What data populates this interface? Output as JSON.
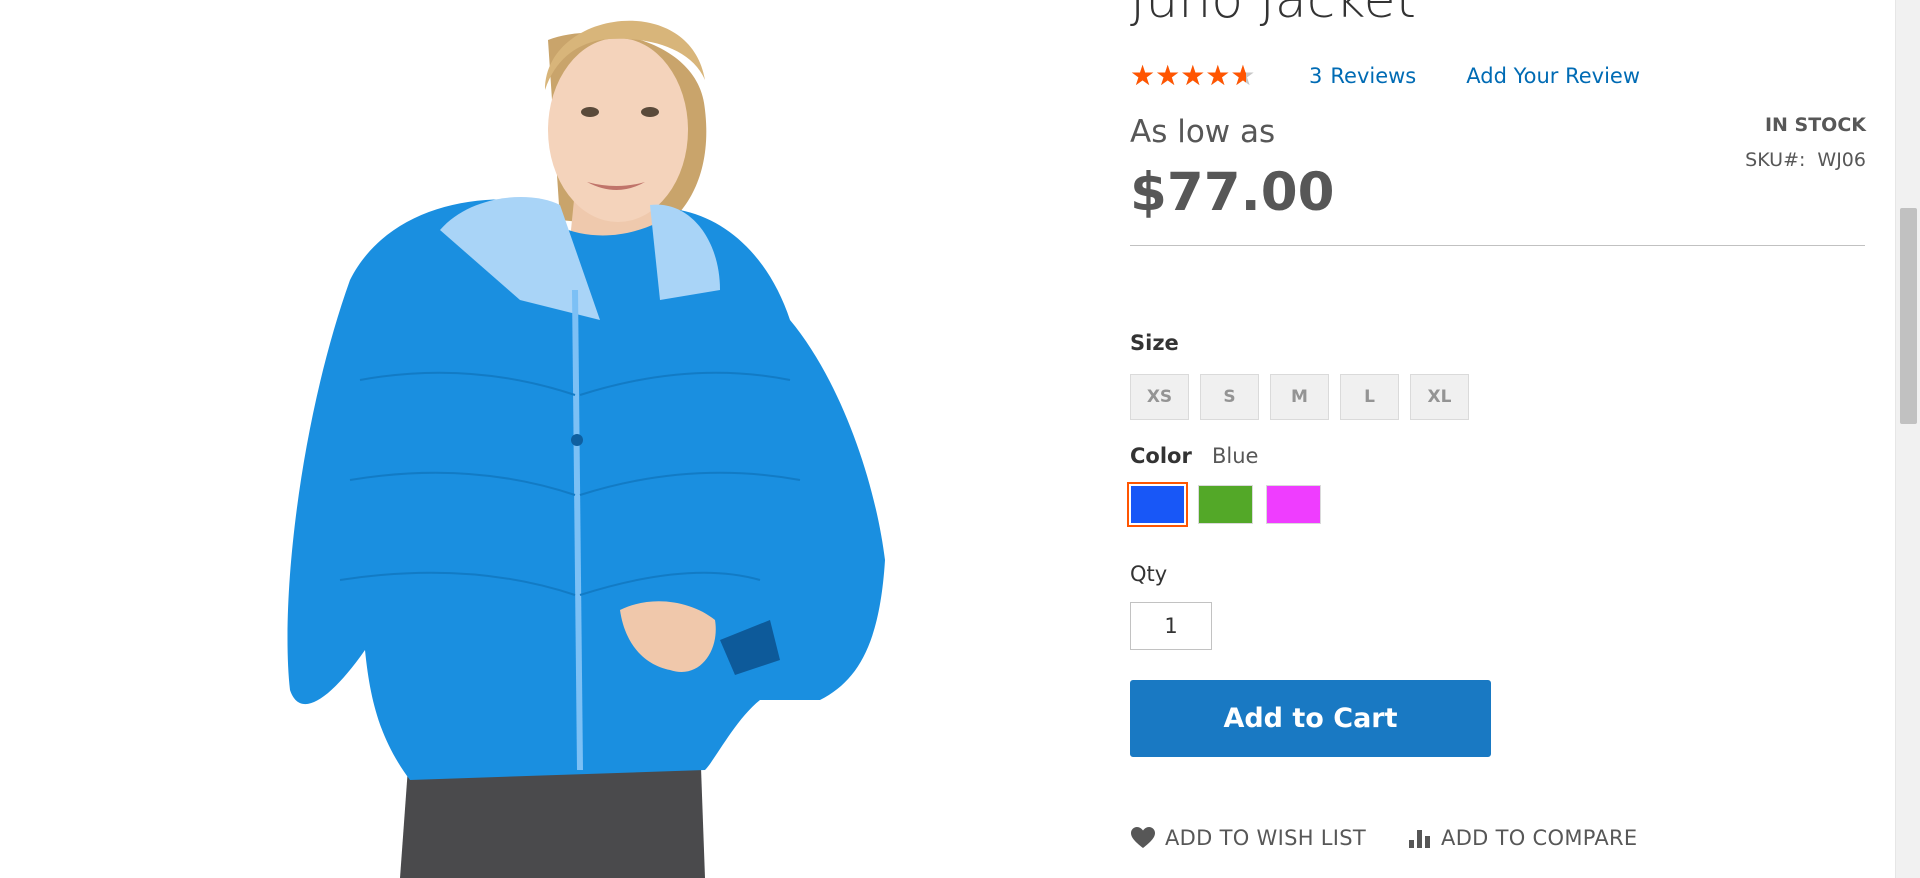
{
  "product": {
    "title": "Juno Jacket",
    "rating_percent": 87,
    "stars_glyphs": "★★★★★",
    "reviews_count": "3",
    "reviews_label": "Reviews",
    "add_review_label": "Add Your Review",
    "price_label": "As low as",
    "price": "$77.00",
    "stock_status": "IN STOCK",
    "sku_label": "SKU#:",
    "sku_value": "WJ06"
  },
  "options": {
    "size_label": "Size",
    "sizes": [
      "XS",
      "S",
      "M",
      "L",
      "XL"
    ],
    "color_label": "Color",
    "color_selected": "Blue",
    "colors": [
      {
        "name": "Blue",
        "hex": "#1857f7",
        "selected": true
      },
      {
        "name": "Green",
        "hex": "#53a828",
        "selected": false
      },
      {
        "name": "Purple",
        "hex": "#ef3dff",
        "selected": false
      }
    ]
  },
  "qty": {
    "label": "Qty",
    "value": "1"
  },
  "actions": {
    "add_to_cart": "Add to Cart",
    "wish_list": "ADD TO WISH LIST",
    "compare": "ADD TO COMPARE"
  },
  "colors": {
    "accent": "#1979c3",
    "link": "#006bb4",
    "star": "#ff5501",
    "selected_outline": "#ff5501"
  },
  "icons": {
    "wish_list": "heart-icon",
    "compare": "bar-chart-icon"
  }
}
